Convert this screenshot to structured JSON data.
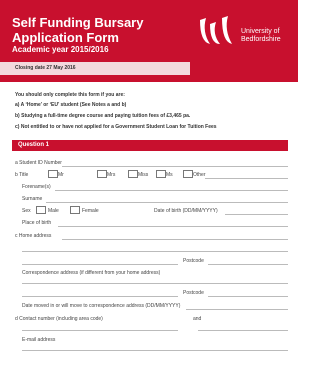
{
  "header": {
    "title_line1": "Self Funding Bursary",
    "title_line2": "Application Form",
    "academic_year": "Academic year 2015/2016",
    "logo_line1": "University of",
    "logo_line2": "Bedfordshire",
    "closing_date": "Closing date 27 May 2016"
  },
  "intro": {
    "lead": "You should only complete this form if you are:",
    "criteria": [
      "a)  A ‘Home’ or ‘EU’ student (See Notes a and b)",
      "b)  Studying a full-time degree course and paying tuition fees of £3,465 pa.",
      "c)  Not entitled to or have not applied for a Government Student Loan for Tuition Fees"
    ]
  },
  "question": {
    "heading": "Question 1",
    "a_student_id": "a  Student ID Number",
    "b_title": "b  Title",
    "title_options": [
      "Mr",
      "Mrs",
      "Miss",
      "Ms",
      "Other"
    ],
    "forenames": "Forename(s)",
    "surname": "Surname",
    "sex": "Sex",
    "sex_options": [
      "Male",
      "Female"
    ],
    "dob": "Date of birth (DD/MM/YYYY)",
    "place_of_birth": "Place of birth",
    "c_home_address": "c  Home address",
    "postcode": "Postcode",
    "correspondence": "Correspondence address (if different from your home address)",
    "postcode2": "Postcode",
    "date_moved": "Date moved in or will move to correspondence address (DD/MM/YYYY)",
    "d_contact": "d  Contact number (including area code)",
    "and": "and",
    "email": "E-mail address"
  }
}
